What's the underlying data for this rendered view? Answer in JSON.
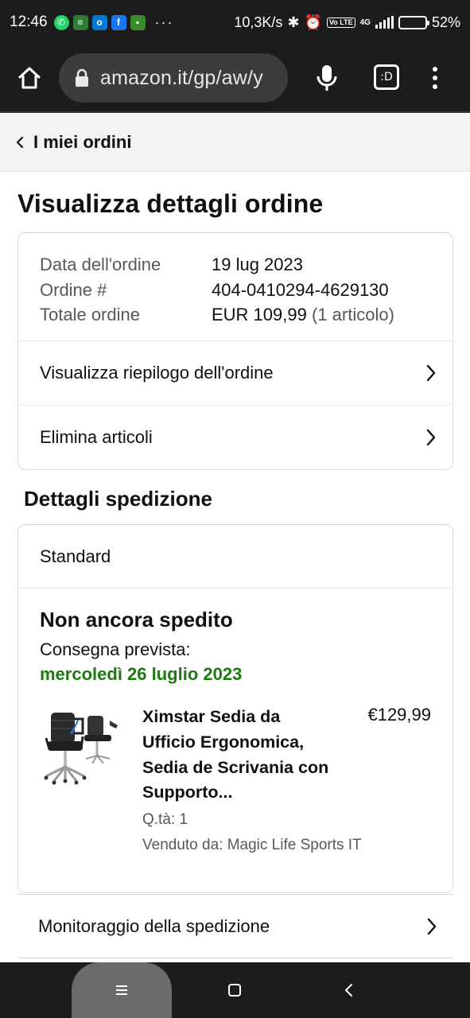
{
  "status_bar": {
    "time": "12:46",
    "more": "···",
    "speed": "10,3K/s",
    "volte": "Vo LTE",
    "network": "4G",
    "battery": "52%",
    "battery_level": 0.52
  },
  "browser": {
    "url": "amazon.it/gp/aw/y",
    "tab_label": ":D"
  },
  "breadcrumb": {
    "label": "I miei ordini"
  },
  "page": {
    "title": "Visualizza dettagli ordine"
  },
  "order": {
    "date_label": "Data dell'ordine",
    "date_value": "19 lug 2023",
    "number_label": "Ordine #",
    "number_value": "404-0410294-4629130",
    "total_label": "Totale ordine",
    "total_value": "EUR 109,99",
    "total_items": "(1 articolo)",
    "links": [
      {
        "label": "Visualizza riepilogo dell'ordine"
      },
      {
        "label": "Elimina articoli"
      }
    ]
  },
  "shipment": {
    "section_title": "Dettagli spedizione",
    "type": "Standard",
    "status": "Non ancora spedito",
    "delivery_label": "Consegna prevista:",
    "delivery_date": "mercoledì 26 luglio 2023",
    "delivery_color": "#1d7a10",
    "item": {
      "title": "Ximstar Sedia da Ufficio Ergonomica, Sedia de Scrivania con Supporto...",
      "price": "€129,99",
      "qty": "Q.tà: 1",
      "seller": "Venduto da: Magic Life Sports IT"
    },
    "tracking_label": "Monitoraggio della spedizione"
  }
}
